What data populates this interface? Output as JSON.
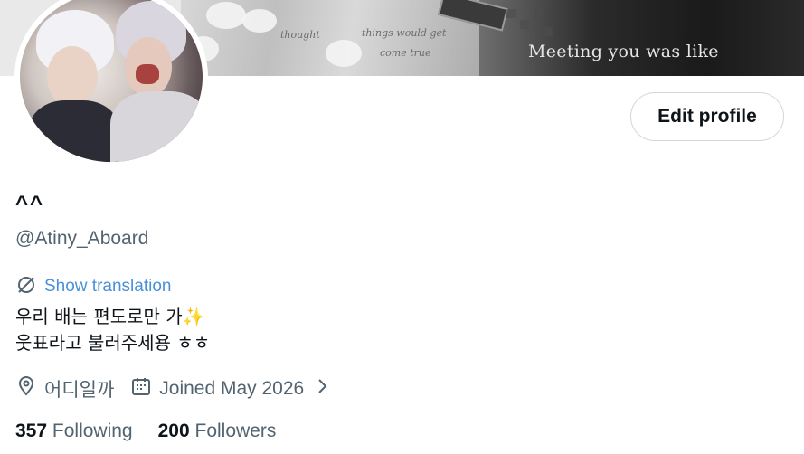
{
  "banner": {
    "caption": "Meeting you was like",
    "script_text_1": "thought",
    "script_text_2": "things would get",
    "script_text_3": "come true"
  },
  "profile": {
    "display_name": "^^",
    "handle": "@Atiny_Aboard",
    "edit_button_label": "Edit profile",
    "translation_link": "Show translation",
    "bio_line_1": "우리 배는 편도로만 가",
    "bio_emoji": "✨",
    "bio_line_2": "웃표라고 불러주세용 ㅎㅎ",
    "location": "어디일까",
    "joined": "Joined May 2026"
  },
  "stats": {
    "following_count": "357",
    "following_label": "Following",
    "followers_count": "200",
    "followers_label": "Followers"
  },
  "icons": {
    "translate": "no-translate-icon",
    "location": "location-pin-icon",
    "calendar": "calendar-icon",
    "chevron": "chevron-right-icon"
  },
  "colors": {
    "accent_link": "#4a90d9",
    "secondary_text": "#536471",
    "primary_text": "#0f1419",
    "border": "#cfd9de"
  }
}
